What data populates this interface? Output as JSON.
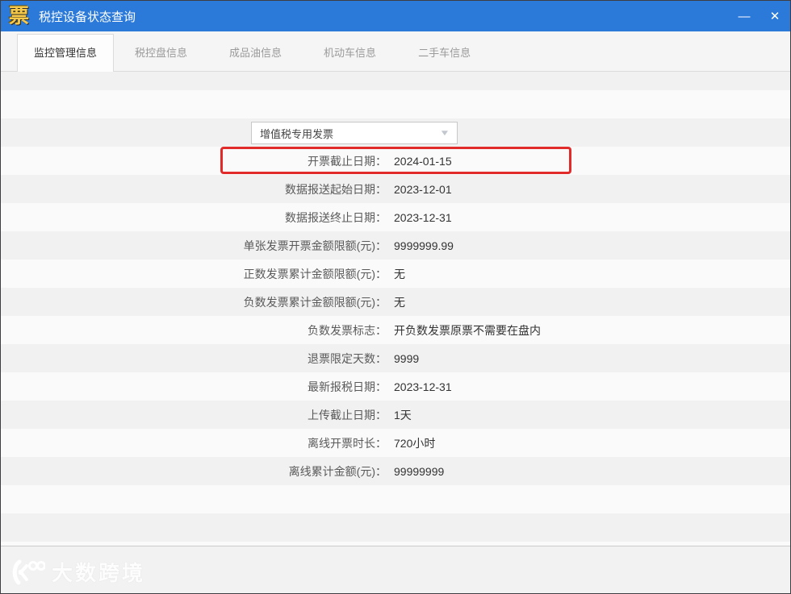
{
  "window": {
    "title": "税控设备状态查询",
    "app_icon_glyph": "票",
    "minimize_glyph": "—",
    "close_glyph": "✕"
  },
  "tabs": [
    {
      "label": "监控管理信息",
      "active": true
    },
    {
      "label": "税控盘信息",
      "active": false
    },
    {
      "label": "成品油信息",
      "active": false
    },
    {
      "label": "机动车信息",
      "active": false
    },
    {
      "label": "二手车信息",
      "active": false
    }
  ],
  "invoice_type_dropdown": {
    "selected": "增值税专用发票",
    "chevron_glyph": "▼"
  },
  "fields": [
    {
      "label": "开票截止日期：",
      "value": "2024-01-15"
    },
    {
      "label": "数据报送起始日期：",
      "value": "2023-12-01"
    },
    {
      "label": "数据报送终止日期：",
      "value": "2023-12-31"
    },
    {
      "label": "单张发票开票金额限额(元)：",
      "value": "9999999.99"
    },
    {
      "label": "正数发票累计金额限额(元)：",
      "value": "无"
    },
    {
      "label": "负数发票累计金额限额(元)：",
      "value": "无"
    },
    {
      "label": "负数发票标志：",
      "value": "开负数发票原票不需要在盘内"
    },
    {
      "label": "退票限定天数：",
      "value": "9999"
    },
    {
      "label": "最新报税日期：",
      "value": "2023-12-31"
    },
    {
      "label": "上传截止日期：",
      "value": "1天"
    },
    {
      "label": "离线开票时长：",
      "value": "720小时"
    },
    {
      "label": "离线累计金额(元)：",
      "value": "99999999"
    }
  ],
  "footer": {
    "brand": "大数跨境"
  },
  "colors": {
    "titlebar": "#2b79d8",
    "highlight_border": "#e12b2b",
    "stripe_gray": "#f1f1f1",
    "stripe_light": "#fafafa"
  }
}
